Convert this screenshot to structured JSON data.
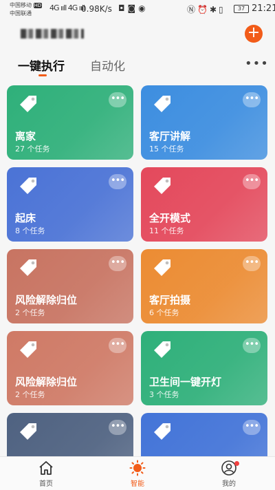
{
  "status": {
    "carrier1": "中国移动",
    "carrier1_badge": "HD",
    "carrier2": "中国联通",
    "signal": "4G ııll 4G ııll",
    "speed": "0.98K/s",
    "battery": "37",
    "time": "21:21"
  },
  "header": {
    "add_symbol": "+"
  },
  "tabs": {
    "active": "一键执行",
    "inactive": "自动化",
    "more": "•••"
  },
  "cards": [
    {
      "name": "离家",
      "count": "27 个任务",
      "color": "#2fb07a"
    },
    {
      "name": "客厅讲解",
      "count": "15 个任务",
      "color": "#3d8ee0"
    },
    {
      "name": "起床",
      "count": "8 个任务",
      "color": "#4b73d6"
    },
    {
      "name": "全开模式",
      "count": "11 个任务",
      "color": "#e4495c"
    },
    {
      "name": "风险解除归位",
      "count": "2 个任务",
      "color": "#c87462"
    },
    {
      "name": "客厅拍摄",
      "count": "6 个任务",
      "color": "#ec8c33"
    },
    {
      "name": "风险解除归位",
      "count": "2 个任务",
      "color": "#cf7a66"
    },
    {
      "name": "卫生间一键开灯",
      "count": "3 个任务",
      "color": "#2fb07a"
    },
    {
      "name": "",
      "count": "",
      "color": "#4f6281"
    },
    {
      "name": "",
      "count": "",
      "color": "#4374d8"
    }
  ],
  "card_more": "•••",
  "nav": {
    "home": "首页",
    "smart": "智能",
    "mine": "我的"
  }
}
